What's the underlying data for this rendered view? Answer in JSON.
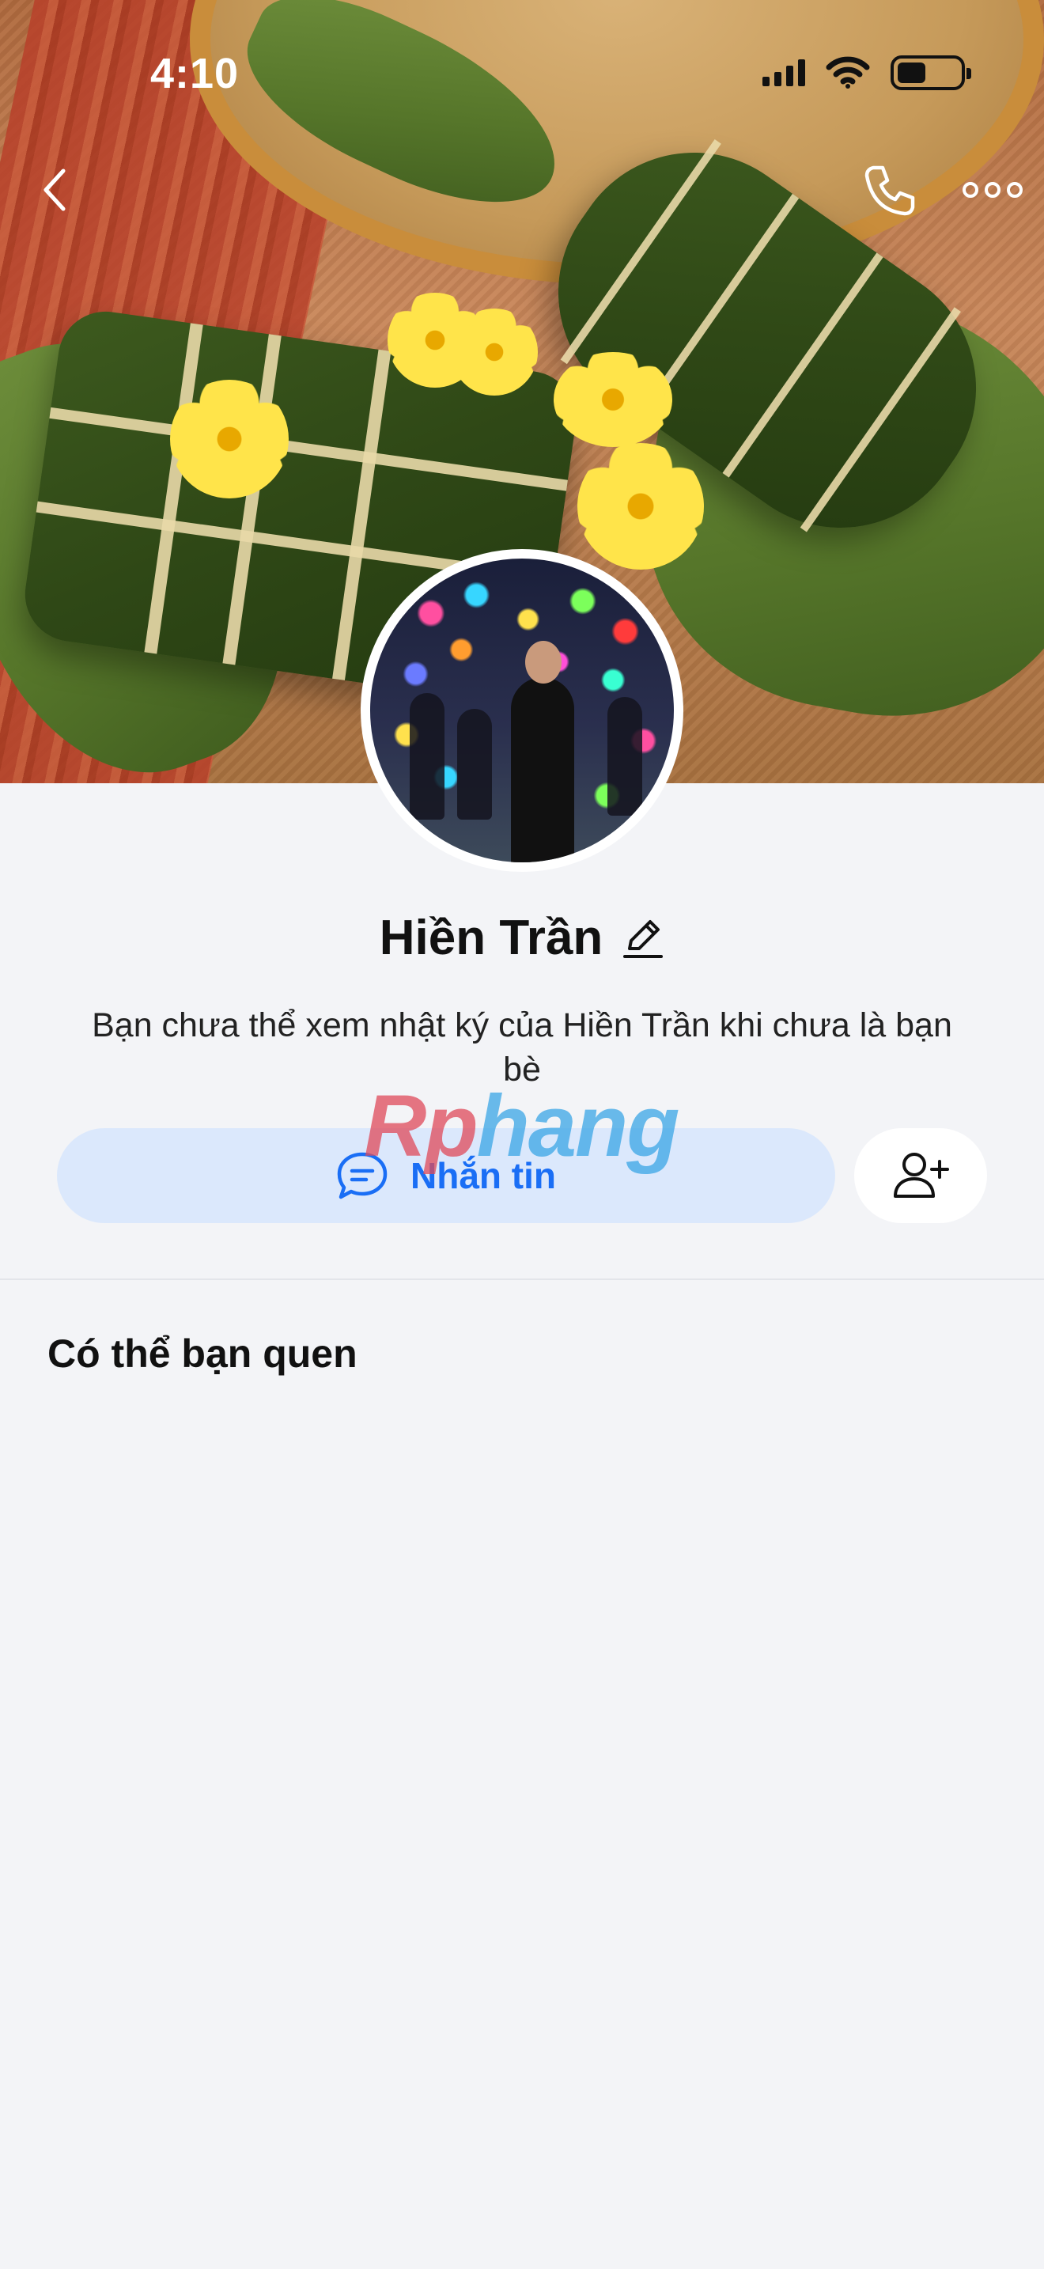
{
  "status_bar": {
    "time": "4:10",
    "icons": [
      "signal-icon",
      "wifi-icon",
      "battery-icon"
    ]
  },
  "top_nav": {
    "back_icon": "chevron-left-icon",
    "call_icon": "phone-icon",
    "more_icon": "more-horizontal-icon"
  },
  "profile": {
    "name": "Hiền Trần",
    "edit_icon": "pencil-icon",
    "privacy_note": "Bạn chưa thể xem nhật ký của Hiền Trần khi chưa là bạn bè"
  },
  "actions": {
    "message_label": "Nhắn tin",
    "message_icon": "chat-bubble-icon",
    "add_friend_icon": "add-user-icon"
  },
  "watermark": {
    "part1": "Rp",
    "part2": "hang"
  },
  "suggestions": {
    "title": "Có thể bạn quen"
  },
  "colors": {
    "accent": "#1a6ef5",
    "message_button_bg": "#dbe8fc",
    "page_bg": "#f3f4f7"
  }
}
